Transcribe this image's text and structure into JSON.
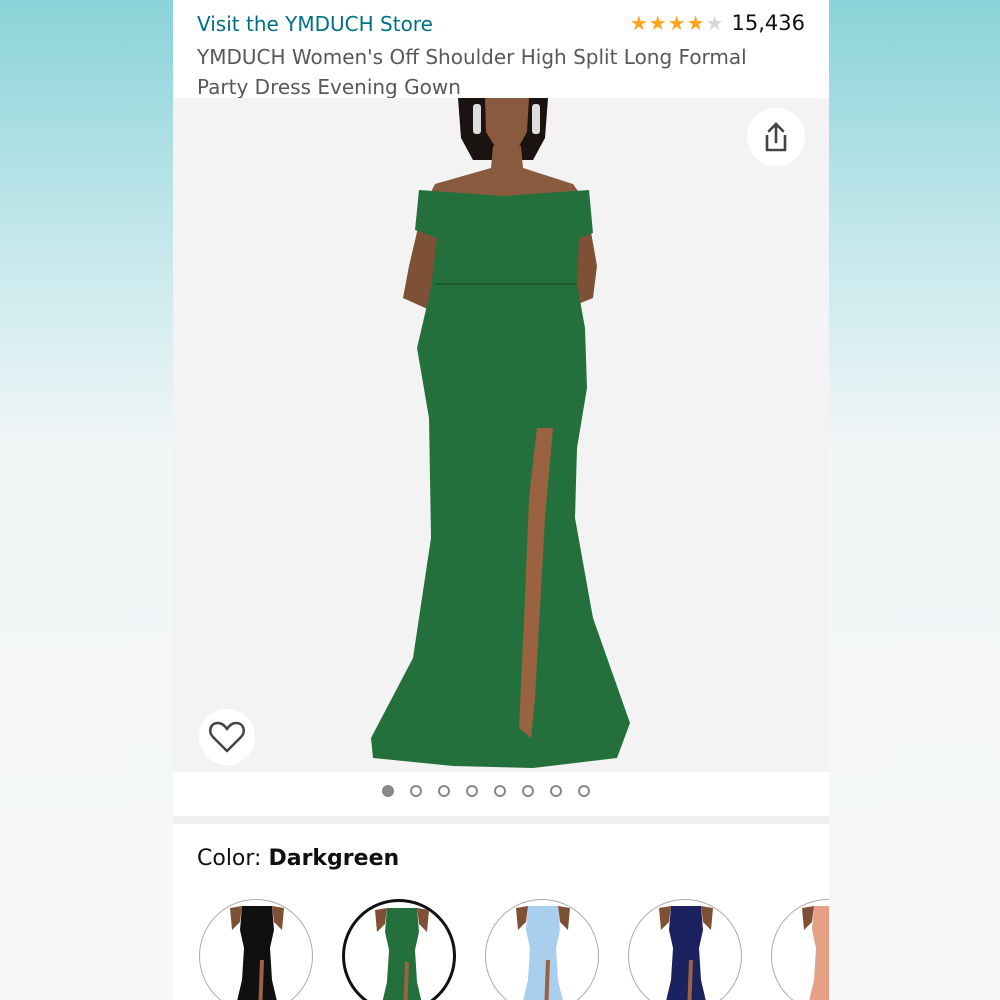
{
  "header": {
    "store_link": "Visit the YMDUCH Store",
    "rating": 4.5,
    "review_count": "15,436",
    "title": "YMDUCH Women's Off Shoulder High Split Long Formal Party Dress Evening Gown"
  },
  "gallery": {
    "image_count": 8,
    "active_index": 0,
    "share_icon": "share-icon",
    "wishlist_icon": "heart-icon",
    "dress_color": "#24703c"
  },
  "color_selector": {
    "label": "Color: ",
    "selected_value": "Darkgreen",
    "swatches": [
      {
        "color": "#101010",
        "selected": false
      },
      {
        "color": "#24703c",
        "selected": true
      },
      {
        "color": "#a9cfee",
        "selected": false
      },
      {
        "color": "#1c2260",
        "selected": false
      },
      {
        "color": "#e5a184",
        "selected": false
      }
    ]
  },
  "colors": {
    "link": "#007185",
    "star": "#ffa41c",
    "text": "#0f1111",
    "muted_text": "#565959"
  }
}
